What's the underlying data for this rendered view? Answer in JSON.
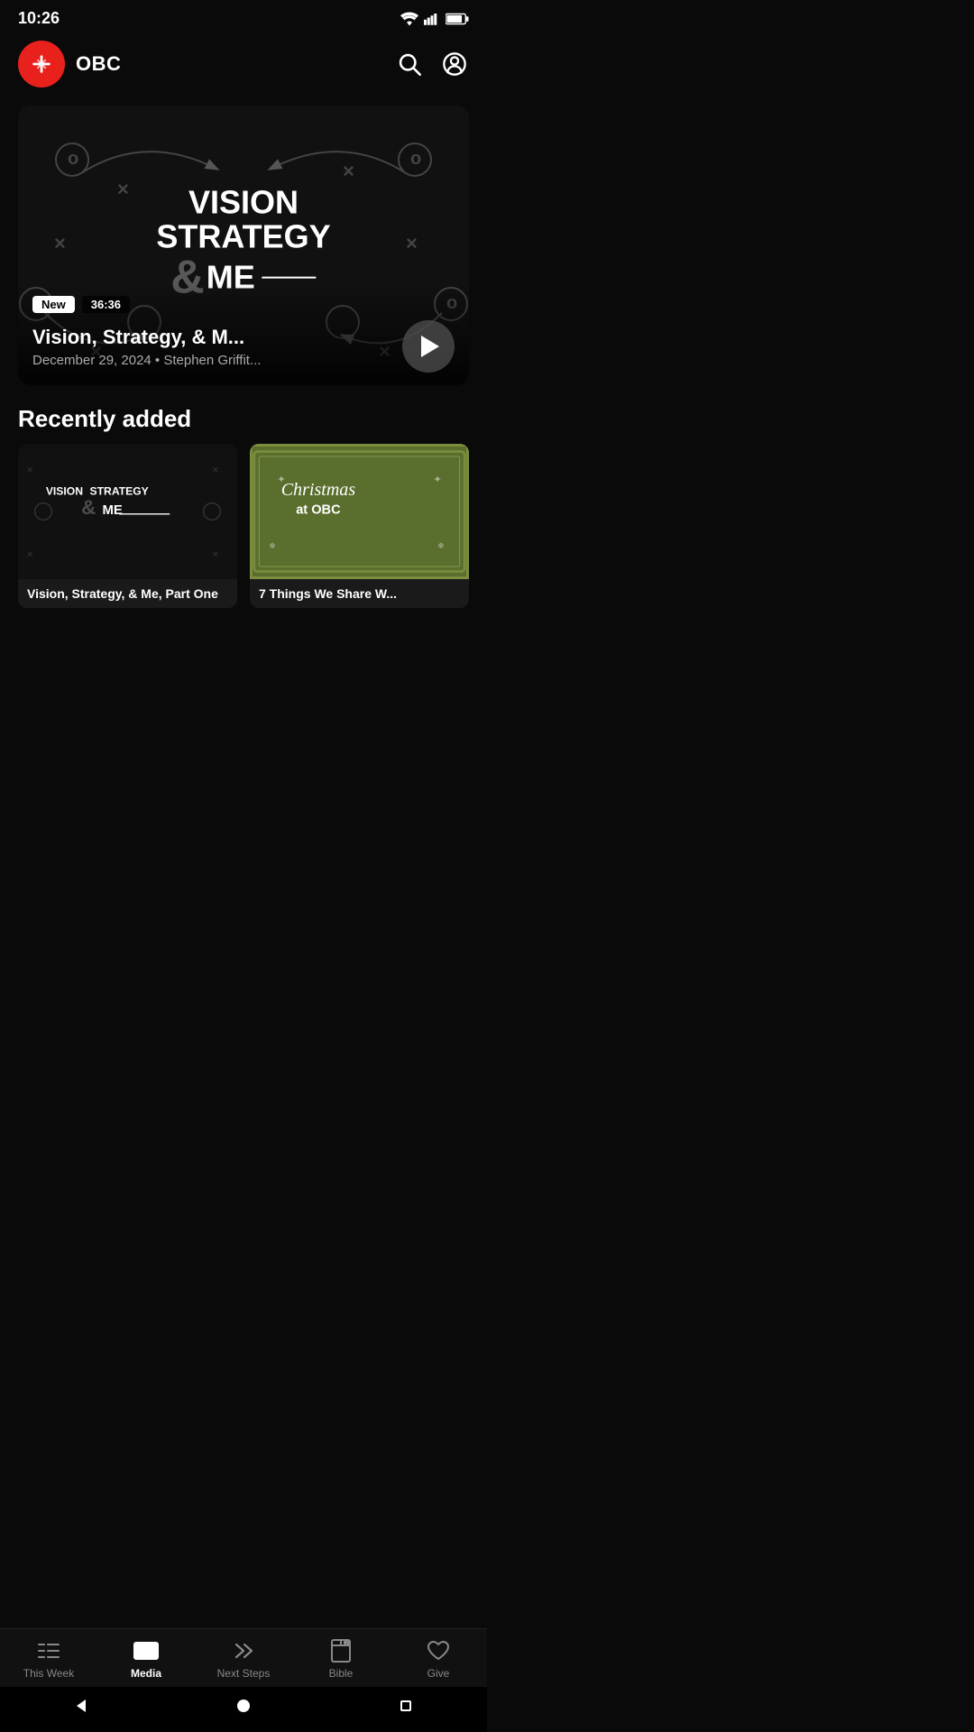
{
  "statusBar": {
    "time": "10:26"
  },
  "header": {
    "appName": "OBC",
    "searchLabel": "search",
    "profileLabel": "profile"
  },
  "hero": {
    "titleLine1": "VISION",
    "titleLine2": "STRATEGY",
    "titleLine3": "& ME",
    "badgeNew": "New",
    "badgeTime": "36:36",
    "sermonTitle": "Vision, Strategy, & M...",
    "meta": "December 29, 2024 • Stephen Griffit...",
    "playLabel": "play"
  },
  "recentlyAdded": {
    "sectionTitle": "Recently added",
    "cards": [
      {
        "thumbType": "dark",
        "thumbText": "VISION STRATEGY & ME",
        "label": "Vision, Strategy, & Me, Part One"
      },
      {
        "thumbType": "green",
        "thumbText": "Christmas at OBC",
        "label": "7 Things We Share W..."
      }
    ]
  },
  "bottomNav": {
    "items": [
      {
        "id": "this-week",
        "label": "This Week",
        "icon": "list-icon",
        "active": false
      },
      {
        "id": "media",
        "label": "Media",
        "icon": "media-icon",
        "active": true
      },
      {
        "id": "next-steps",
        "label": "Next Steps",
        "icon": "forward-icon",
        "active": false
      },
      {
        "id": "bible",
        "label": "Bible",
        "icon": "bible-icon",
        "active": false
      },
      {
        "id": "give",
        "label": "Give",
        "icon": "heart-icon",
        "active": false
      }
    ]
  },
  "androidNav": {
    "back": "back",
    "home": "home",
    "recent": "recent"
  }
}
